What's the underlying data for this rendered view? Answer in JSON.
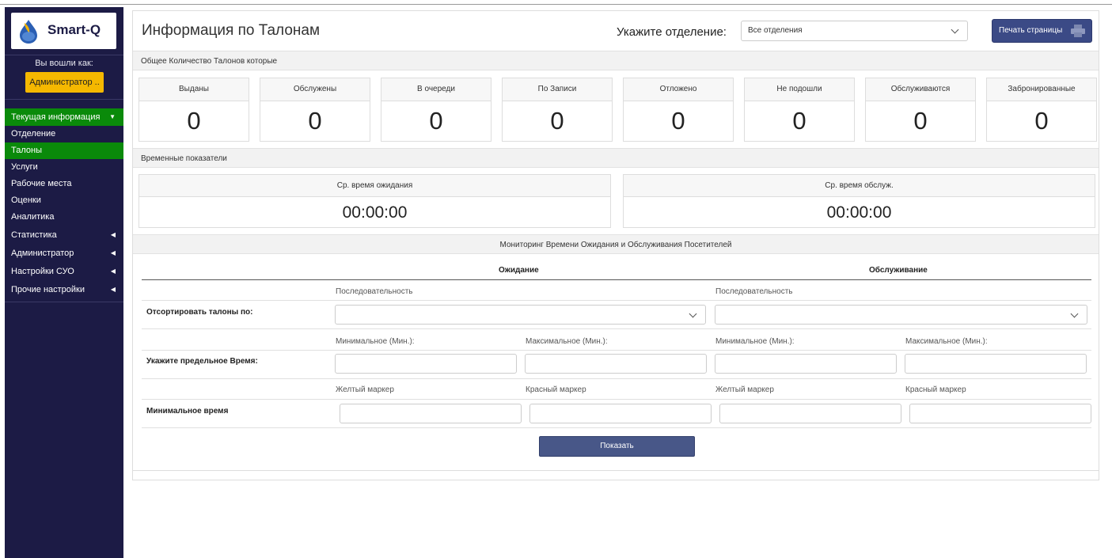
{
  "app": {
    "logo_text": "Smart-Q"
  },
  "sidebar": {
    "logged_in_label": "Вы вошли как:",
    "role": "Администратор ..",
    "menu": [
      {
        "label": "Текущая информация",
        "active": true
      },
      {
        "label": "Статистика"
      },
      {
        "label": "Администратор"
      },
      {
        "label": "Настройки СУО"
      },
      {
        "label": "Прочие настройки"
      }
    ],
    "submenu": [
      {
        "label": "Отделение"
      },
      {
        "label": "Талоны",
        "active": true
      },
      {
        "label": "Услуги"
      },
      {
        "label": "Рабочие места"
      },
      {
        "label": "Оценки"
      },
      {
        "label": "Аналитика"
      }
    ]
  },
  "header": {
    "title": "Информация по Талонам",
    "dept_label": "Укажите отделение:",
    "dept_value": "Все отделения",
    "print_label": "Печать страницы"
  },
  "totals": {
    "section_title": "Общее Количество Талонов которые",
    "items": [
      {
        "label": "Выданы",
        "value": "0"
      },
      {
        "label": "Обслужены",
        "value": "0"
      },
      {
        "label": "В очереди",
        "value": "0"
      },
      {
        "label": "По Записи",
        "value": "0"
      },
      {
        "label": "Отложено",
        "value": "0"
      },
      {
        "label": "Не подошли",
        "value": "0"
      },
      {
        "label": "Обслуживаются",
        "value": "0"
      },
      {
        "label": "Забронированные",
        "value": "0"
      }
    ]
  },
  "time_stats": {
    "section_title": "Временные показатели",
    "wait": {
      "label": "Ср. время ожидания",
      "value": "00:00:00"
    },
    "service": {
      "label": "Ср. время обслуж.",
      "value": "00:00:00"
    }
  },
  "monitoring": {
    "section_title": "Мониторинг Времени Ожидания и Обслуживания Посетителей",
    "wait_head": "Ожидание",
    "service_head": "Обслуживание",
    "sequence_label": "Последовательность",
    "sort_label": "Отсортировать талоны по:",
    "min_label": "Минимальное (Мин.):",
    "max_label": "Максимальное (Мин.):",
    "limit_label": "Укажите предельное Время:",
    "yellow_label": "Желтый маркер",
    "red_label": "Красный маркер",
    "min_time_label": "Минимальное время",
    "show_button": "Показать"
  },
  "colors": {
    "sidebar_bg": "#1c1b45",
    "active_green": "#0a8a0a",
    "role_yellow": "#f5b800",
    "button_blue": "#3b4a86"
  }
}
